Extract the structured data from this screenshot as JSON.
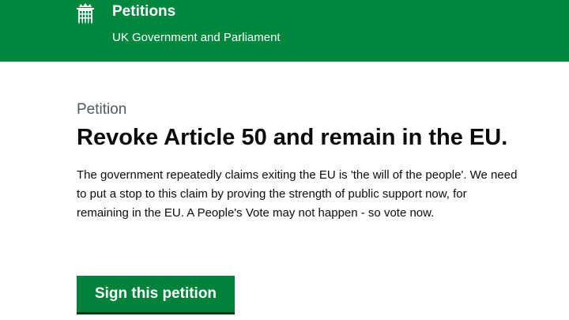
{
  "header": {
    "title": "Petitions",
    "subtitle": "UK Government and Parliament",
    "icon": "portcullis-icon",
    "background_color": "#00873e"
  },
  "petition": {
    "caption": "Petition",
    "title": "Revoke Article 50 and remain in the EU.",
    "description": "The government repeatedly claims exiting the EU is 'the will of the people'. We need to put a stop to this claim by proving the strength of public support now, for remaining in the EU. A People's Vote may not happen - so vote now."
  },
  "actions": {
    "sign_label": "Sign this petition",
    "button_color": "#00823b"
  }
}
